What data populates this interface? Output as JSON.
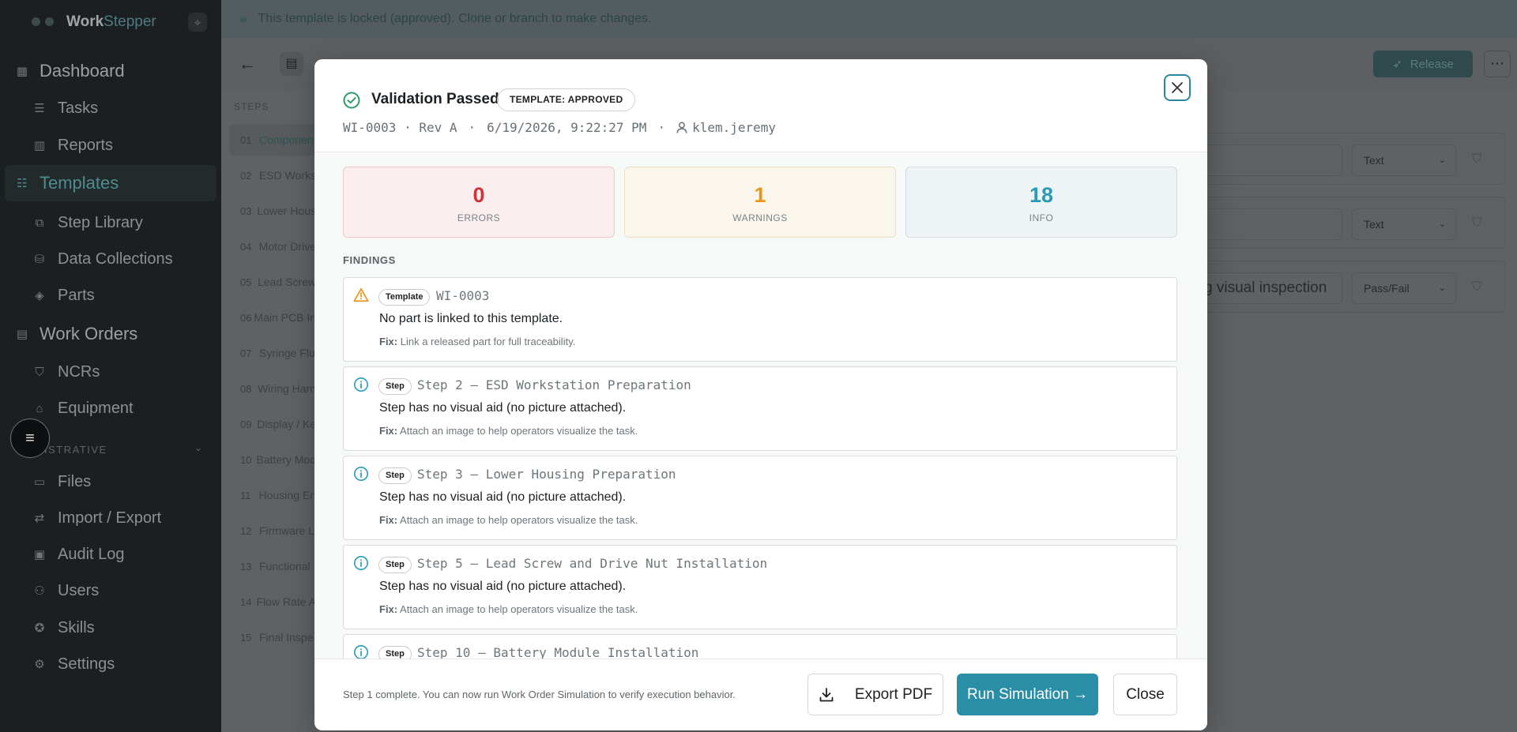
{
  "app": {
    "brand_part1": "Work",
    "brand_part2": "Stepper"
  },
  "sidebar": {
    "items": [
      {
        "label": "Dashboard"
      },
      {
        "label": "Tasks"
      },
      {
        "label": "Reports"
      },
      {
        "label": "Templates"
      },
      {
        "label": "Step Library"
      },
      {
        "label": "Data Collections"
      },
      {
        "label": "Parts"
      },
      {
        "label": "Work Orders"
      },
      {
        "label": "NCRs"
      },
      {
        "label": "Equipment"
      },
      {
        "label": "Files"
      },
      {
        "label": "Import / Export"
      },
      {
        "label": "Audit Log"
      },
      {
        "label": "Users"
      },
      {
        "label": "Skills"
      },
      {
        "label": "Settings"
      }
    ],
    "section_label": "ISTRATIVE"
  },
  "lock_banner": {
    "text": "This template is locked (approved). Clone or branch to make changes."
  },
  "toolbar": {
    "release_label": "Release"
  },
  "steps_panel": {
    "heading": "STEPS",
    "steps": [
      {
        "num": "01",
        "title": "Componen"
      },
      {
        "num": "02",
        "title": "ESD Works"
      },
      {
        "num": "03",
        "title": "Lower Hous"
      },
      {
        "num": "04",
        "title": "Motor Drive"
      },
      {
        "num": "05",
        "title": "Lead Screw"
      },
      {
        "num": "06",
        "title": "Main PCB In"
      },
      {
        "num": "07",
        "title": "Syringe Flu"
      },
      {
        "num": "08",
        "title": "Wiring Harn"
      },
      {
        "num": "09",
        "title": "Display / Ke"
      },
      {
        "num": "10",
        "title": "Battery Mod"
      },
      {
        "num": "11",
        "title": "Housing En"
      },
      {
        "num": "12",
        "title": "Firmware L"
      },
      {
        "num": "13",
        "title": "Functional"
      },
      {
        "num": "14",
        "title": "Flow Rate A"
      },
      {
        "num": "15",
        "title": "Final Inspe"
      }
    ]
  },
  "field_rows": [
    {
      "input": "",
      "type": "Text"
    },
    {
      "input": "",
      "type": "Text"
    },
    {
      "input": "g visual inspection",
      "type": "Pass/Fail"
    }
  ],
  "modal": {
    "title": "Validation Passed",
    "status_badge": "TEMPLATE: APPROVED",
    "meta": {
      "doc_id": "WI-0003 · Rev A",
      "timestamp": "6/19/2026, 9:22:27 PM",
      "user": "klem.jeremy",
      "separator": "·"
    },
    "stats": {
      "errors": {
        "value": "0",
        "label": "ERRORS"
      },
      "warnings": {
        "value": "1",
        "label": "WARNINGS"
      },
      "info": {
        "value": "18",
        "label": "INFO"
      }
    },
    "findings_label": "FINDINGS",
    "fix_label": "Fix:",
    "findings": [
      {
        "severity": "warning",
        "kind": "Template",
        "ref": "WI-0003",
        "message": "No part is linked to this template.",
        "fix": "Link a released part for full traceability."
      },
      {
        "severity": "info",
        "kind": "Step",
        "ref": "Step 2 — ESD Workstation Preparation",
        "message": "Step has no visual aid (no picture attached).",
        "fix": "Attach an image to help operators visualize the task."
      },
      {
        "severity": "info",
        "kind": "Step",
        "ref": "Step 3 — Lower Housing Preparation",
        "message": "Step has no visual aid (no picture attached).",
        "fix": "Attach an image to help operators visualize the task."
      },
      {
        "severity": "info",
        "kind": "Step",
        "ref": "Step 5 — Lead Screw and Drive Nut Installation",
        "message": "Step has no visual aid (no picture attached).",
        "fix": "Attach an image to help operators visualize the task."
      },
      {
        "severity": "info",
        "kind": "Step",
        "ref": "Step 10 — Battery Module Installation",
        "message": "",
        "fix": ""
      }
    ],
    "footer": {
      "note": "Step 1 complete. You can now run Work Order Simulation to verify execution behavior.",
      "export_label": "Export PDF",
      "run_label": "Run Simulation →",
      "close_label": "Close"
    }
  },
  "colors": {
    "accent": "#2a8fa6",
    "error": "#d0323a",
    "warning": "#e8961e",
    "info": "#2a9bb4",
    "success": "#2e9a6a"
  }
}
